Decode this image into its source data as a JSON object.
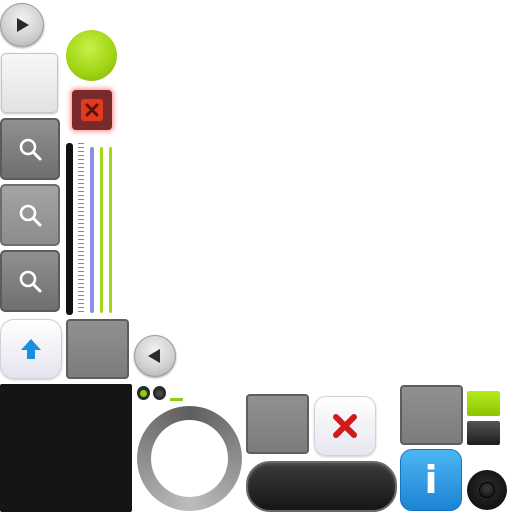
{
  "title": "",
  "theme": {
    "lime": "#a3d616",
    "red": "#e33a1c",
    "blue": "#1b83d4",
    "slider_blue": "#8b8bf0",
    "dark": "#151515",
    "grey": "#808080"
  },
  "icons": {
    "play_right": "triangle-right",
    "play_left": "triangle-left",
    "search": "magnifier",
    "close": "x",
    "up_arrow": "arrow-up",
    "info": "letter-i"
  },
  "info_button": {
    "glyph": "i"
  }
}
